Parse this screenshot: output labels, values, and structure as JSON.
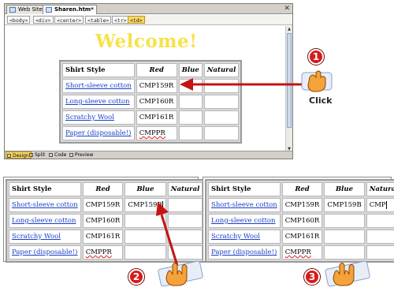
{
  "tabs": [
    {
      "label": "Web Site"
    },
    {
      "label": "Sharen.htm*"
    }
  ],
  "tag_selector": [
    "<body>",
    "<div>",
    "<center>",
    "<table>",
    "<tr>",
    "<td>"
  ],
  "page_heading": "Welcome!",
  "view_modes": [
    "Design",
    "Split",
    "Code",
    "Preview"
  ],
  "columns": [
    "Shirt Style",
    "Red",
    "Blue",
    "Natural"
  ],
  "rows": [
    {
      "style": "Short-sleeve cotton",
      "red": "CMP159R"
    },
    {
      "style": "Long-sleeve cotton",
      "red": "CMP160R"
    },
    {
      "style": "Scratchy Wool",
      "red": "CMP161R"
    },
    {
      "style": "Paper (disposable!)",
      "red": "CMPPR"
    }
  ],
  "step2_blue_value": "CMP159B",
  "step3_blue_value": "CMP159B",
  "step3_natural_value": "CMP",
  "callouts": {
    "step1": "1",
    "step2": "2",
    "step3": "3",
    "click_label": "Click"
  },
  "colors": {
    "heading": "#f6e24a",
    "link": "#1a3fc4",
    "callout": "#d61b1b",
    "arrow": "#c41414",
    "current_tag": "#f7d76a"
  }
}
